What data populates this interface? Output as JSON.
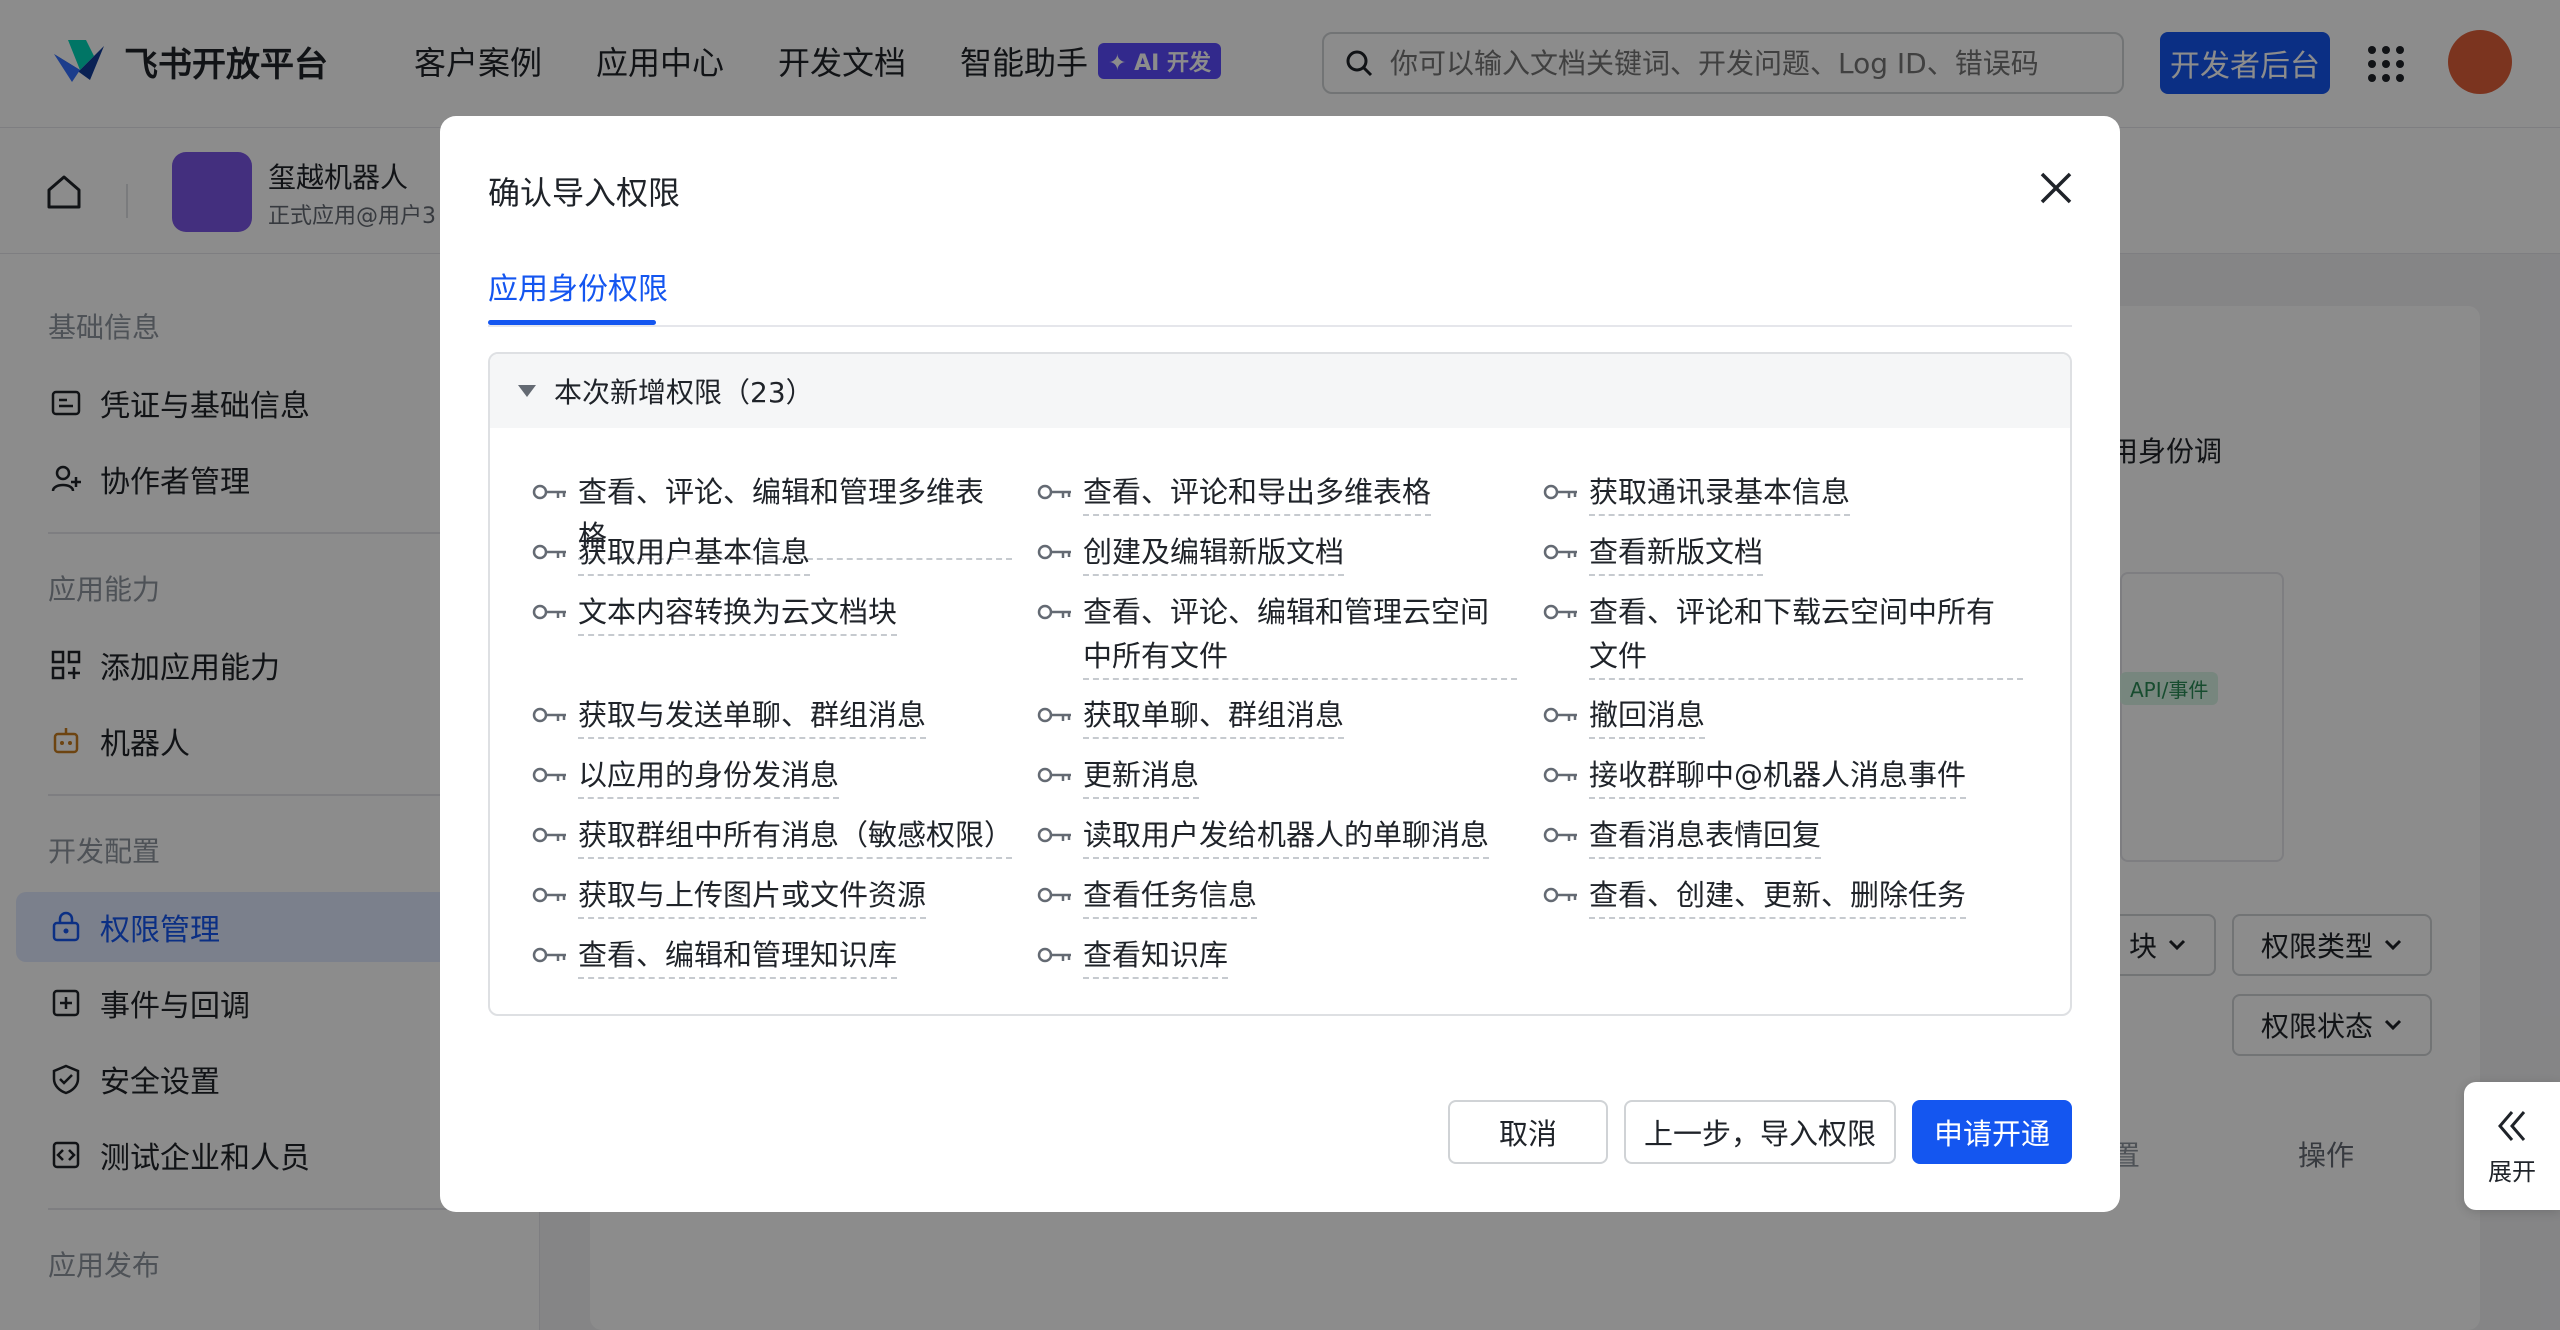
{
  "nav": {
    "brand": "飞书开放平台",
    "items": [
      "客户案例",
      "应用中心",
      "开发文档",
      "智能助手"
    ],
    "ai_badge": "✦ AI 开发",
    "search_placeholder": "你可以输入文档关键词、开发问题、Log ID、错误码",
    "dev_button": "开发者后台"
  },
  "app": {
    "name": "玺越机器人",
    "subtitle": "正式应用@用户3"
  },
  "sidebar": {
    "groups": [
      "基础信息",
      "应用能力",
      "开发配置",
      "应用发布"
    ],
    "items": [
      {
        "label": "凭证与基础信息",
        "icon": "credential-icon"
      },
      {
        "label": "协作者管理",
        "icon": "user-add-icon"
      },
      {
        "label": "添加应用能力",
        "icon": "apps-icon"
      },
      {
        "label": "机器人",
        "icon": "robot-icon"
      },
      {
        "label": "权限管理",
        "icon": "lock-icon"
      },
      {
        "label": "事件与回调",
        "icon": "event-icon"
      },
      {
        "label": "安全设置",
        "icon": "shield-icon"
      },
      {
        "label": "测试企业和人员",
        "icon": "code-icon"
      }
    ]
  },
  "main": {
    "partial_text": "用身份调",
    "api_tag": "API/事件",
    "filter_module": "块",
    "filter_type": "权限类型",
    "filter_status": "权限状态",
    "col_partial": "置",
    "col_action": "操作"
  },
  "expand_label": "展开",
  "modal": {
    "title": "确认导入权限",
    "tab": "应用身份权限",
    "section_title": "本次新增权限（23）",
    "permissions": [
      "查看、评论、编辑和管理多维表格",
      "查看、评论和导出多维表格",
      "获取通讯录基本信息",
      "获取用户基本信息",
      "创建及编辑新版文档",
      "查看新版文档",
      "文本内容转换为云文档块",
      "查看、评论、编辑和管理云空间中所有文件",
      "查看、评论和下载云空间中所有文件",
      "获取与发送单聊、群组消息",
      "获取单聊、群组消息",
      "撤回消息",
      "以应用的身份发消息",
      "更新消息",
      "接收群聊中@机器人消息事件",
      "获取群组中所有消息（敏感权限）",
      "读取用户发给机器人的单聊消息",
      "查看消息表情回复",
      "获取与上传图片或文件资源",
      "查看任务信息",
      "查看、创建、更新、删除任务",
      "查看、编辑和管理知识库",
      "查看知识库"
    ],
    "buttons": {
      "cancel": "取消",
      "back": "上一步，导入权限",
      "submit": "申请开通"
    }
  },
  "colors": {
    "primary": "#1456f0",
    "ai_badge": "#5b4bff"
  }
}
